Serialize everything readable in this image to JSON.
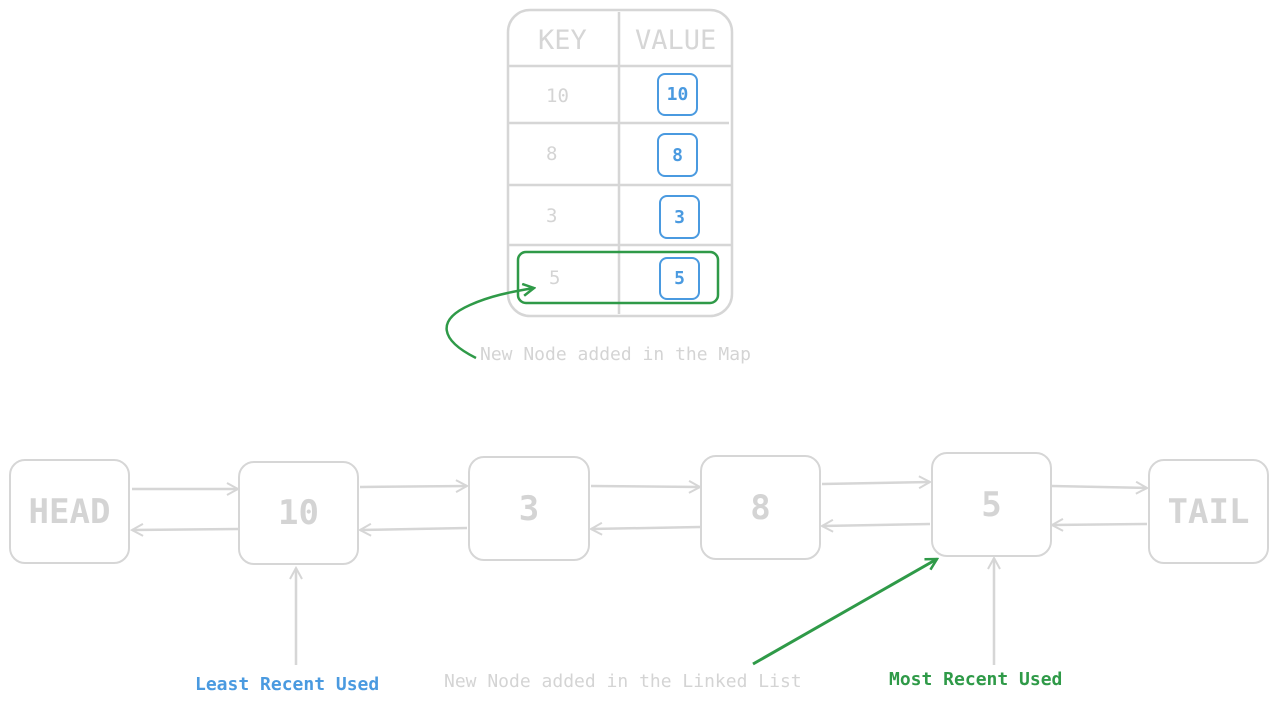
{
  "colors": {
    "outline": "#d6d6d6",
    "muted_text": "#d4d4d4",
    "value_blue": "#4a9ae0",
    "highlight_green": "#2f9a48"
  },
  "map_table": {
    "headers": {
      "key": "KEY",
      "value": "VALUE"
    },
    "rows": [
      {
        "key": "10",
        "value": "10",
        "highlighted": false
      },
      {
        "key": "8",
        "value": "8",
        "highlighted": false
      },
      {
        "key": "3",
        "value": "3",
        "highlighted": false
      },
      {
        "key": "5",
        "value": "5",
        "highlighted": true
      }
    ],
    "annotation": "New Node added in the Map"
  },
  "linked_list": {
    "nodes": [
      {
        "label": "HEAD",
        "role": "sentinel"
      },
      {
        "label": "10",
        "role": "node"
      },
      {
        "label": "3",
        "role": "node"
      },
      {
        "label": "8",
        "role": "node"
      },
      {
        "label": "5",
        "role": "node"
      },
      {
        "label": "TAIL",
        "role": "sentinel"
      }
    ],
    "links": "doubly-linked"
  },
  "annotations": {
    "least_recent": "Least Recent Used",
    "new_node_list": "New Node added in the Linked List",
    "most_recent": "Most Recent Used"
  }
}
